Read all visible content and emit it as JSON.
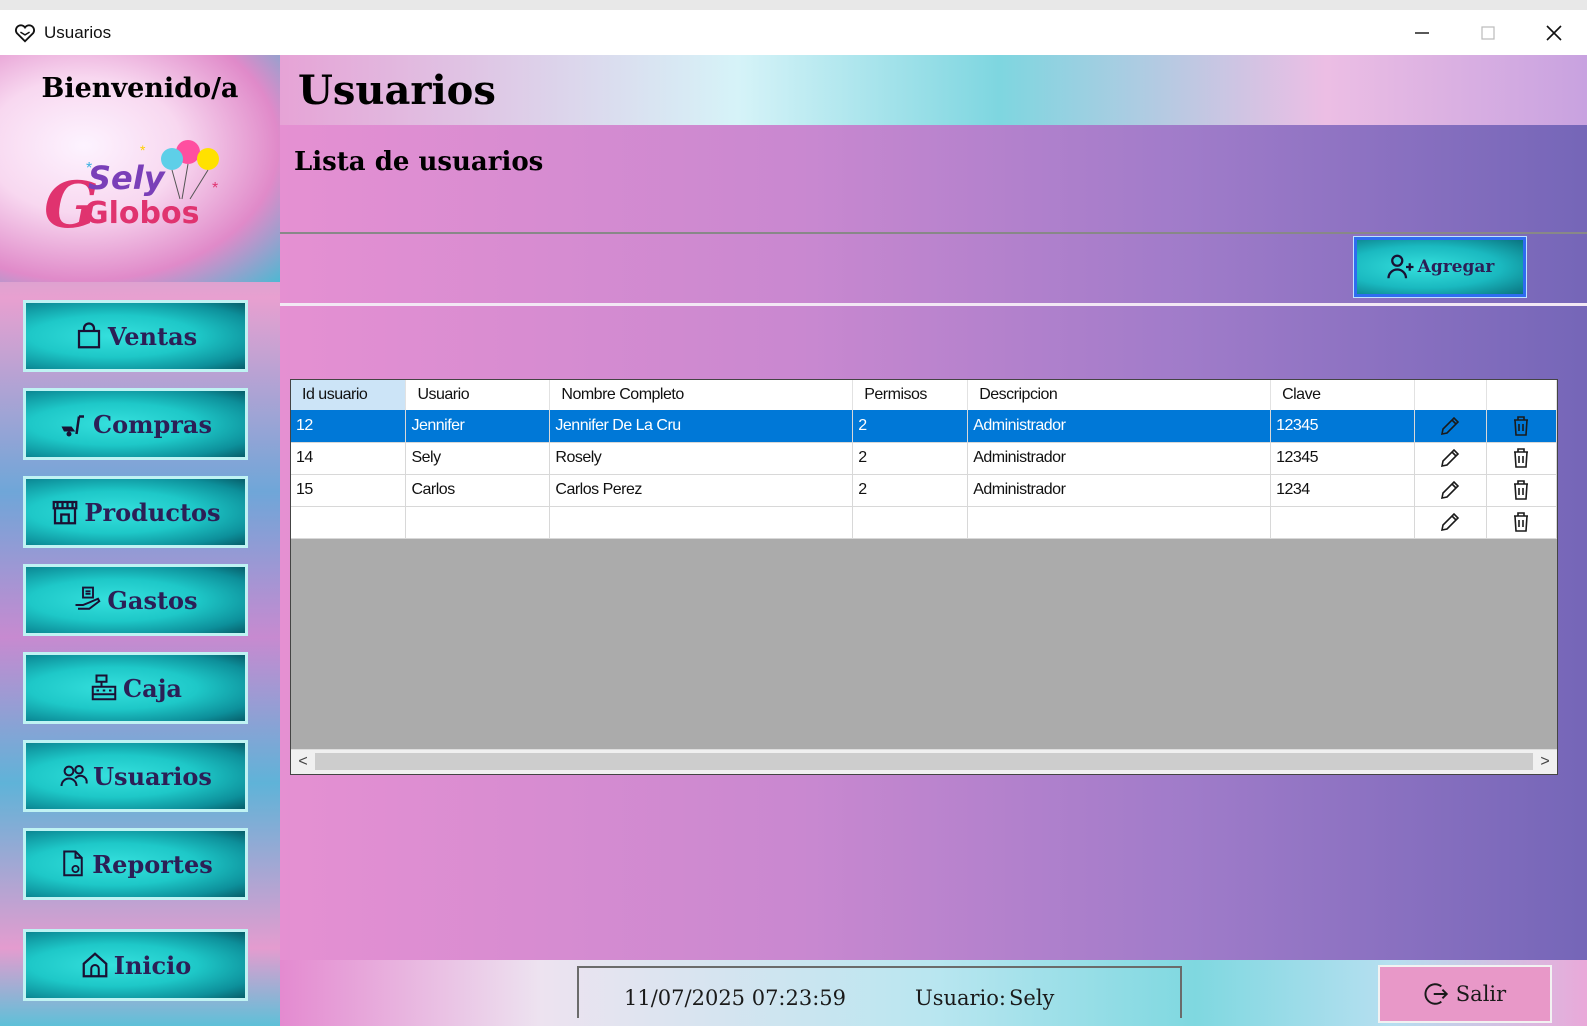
{
  "window": {
    "title": "Usuarios",
    "minimize_icon": "minimize-icon",
    "maximize_icon": "maximize-icon",
    "close_icon": "close-icon"
  },
  "sidebar": {
    "welcome": "Bienvenido/a",
    "logo_text_top": "Sely",
    "logo_text_bottom": "Globos",
    "items": [
      {
        "label": "Ventas",
        "icon": "shopping-bag-icon"
      },
      {
        "label": "Compras",
        "icon": "hand-cart-icon"
      },
      {
        "label": "Productos",
        "icon": "store-icon"
      },
      {
        "label": "Gastos",
        "icon": "hand-receipt-icon"
      },
      {
        "label": "Caja",
        "icon": "cash-register-icon"
      },
      {
        "label": "Usuarios",
        "icon": "users-icon"
      },
      {
        "label": "Reportes",
        "icon": "report-icon"
      },
      {
        "label": "Inicio",
        "icon": "home-icon"
      }
    ]
  },
  "header": {
    "title": "Usuarios"
  },
  "main": {
    "list_title": "Lista de usuarios",
    "add_button": {
      "label": "Agregar",
      "icon": "add-user-icon"
    }
  },
  "table": {
    "columns": [
      "Id usuario",
      "Usuario",
      "Nombre Completo",
      "Permisos",
      "Descripcion",
      "Clave",
      "",
      ""
    ],
    "rows": [
      {
        "id": "12",
        "usuario": "Jennifer",
        "nombre": "Jennifer De La Cru",
        "permisos": "2",
        "descripcion": "Administrador",
        "clave": "12345"
      },
      {
        "id": "14",
        "usuario": "Sely",
        "nombre": "Rosely",
        "permisos": "2",
        "descripcion": "Administrador",
        "clave": "12345"
      },
      {
        "id": "15",
        "usuario": "Carlos",
        "nombre": "Carlos Perez",
        "permisos": "2",
        "descripcion": "Administrador",
        "clave": "1234"
      },
      {
        "id": "",
        "usuario": "",
        "nombre": "",
        "permisos": "",
        "descripcion": "",
        "clave": ""
      }
    ],
    "selected_row": 0,
    "edit_icon": "pencil-icon",
    "delete_icon": "trash-icon",
    "scroll_left": "<",
    "scroll_right": ">"
  },
  "footer": {
    "datetime": "11/07/2025 07:23:59",
    "user_label": "Usuario:",
    "user_value": "Sely",
    "exit_button": {
      "label": "Salir",
      "icon": "logout-icon"
    }
  },
  "colors": {
    "nav_button": "#1ec8c8",
    "selected_row": "#0078d7",
    "exit_button": "#e898c8"
  }
}
